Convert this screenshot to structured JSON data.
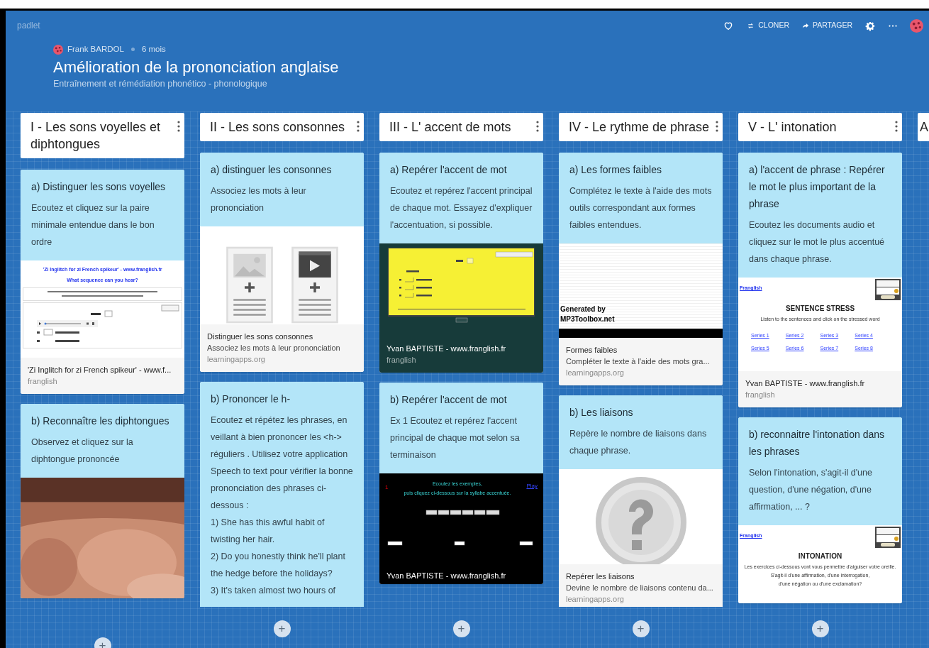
{
  "app": {
    "logo": "padlet"
  },
  "toolbar": [
    {
      "kind": "like"
    },
    {
      "kind": "clone",
      "label": "CLONER"
    },
    {
      "kind": "share",
      "label": "PARTAGER"
    },
    {
      "kind": "settings"
    },
    {
      "kind": "more"
    },
    {
      "kind": "avatar"
    }
  ],
  "board": {
    "author": "Frank BARDOL",
    "age": "6 mois",
    "title": "Amélioration de la prononciation anglaise",
    "subtitle": "Entraînement et rémédiation phonético - phonologique"
  },
  "columns": [
    {
      "title": "I - Les sons voyelles et diphtongues",
      "add_label": "+",
      "posts": [
        {
          "title": "a) Distinguer les sons voyelles",
          "body": [
            "Ecoutez et cliquez sur la paire minimale entendue dans le bon ordre"
          ],
          "attachment": {
            "dark": false,
            "preview": {
              "kind": "pairs_page",
              "heading": "'Zi Inglitch for zi French spikeur' - www.franglish.fr",
              "question": "What sequence can you hear?"
            },
            "title": "'Zi Inglitch for zi French spikeur' - www.f...",
            "source": "franglish"
          }
        },
        {
          "title": "b) Reconnaître les diphtongues",
          "body": [
            "Observez et cliquez sur la diphtongue prononcée"
          ],
          "attachment": {
            "preview": {
              "kind": "picture"
            }
          }
        }
      ]
    },
    {
      "title": "II - Les sons consonnes",
      "add_label": "+",
      "posts": [
        {
          "title": "a) distinguer les consonnes",
          "body": [
            "Associez les mots à leur prononciation"
          ],
          "attachment": {
            "dark": false,
            "preview": {
              "kind": "doc_placeholders"
            },
            "title": "Distinguer les sons consonnes",
            "description": "Associez les mots à leur prononciation",
            "source": "learningapps.org"
          }
        },
        {
          "title": "b) Prononcer le h-",
          "body": [
            "Ecoutez et répétez les phrases, en veillant à bien prononcer les <h-> réguliers . Utilisez votre application Speech to text pour vérifier la bonne prononciation des phrases ci-dessous :",
            "1) She has this awful habit of twisting her hair.",
            "2) Do you honestly think he'll plant the hedge before the holidays?",
            "3) It's taken almost two hours of"
          ]
        }
      ]
    },
    {
      "title": "III - L' accent de mots",
      "add_label": "+",
      "posts": [
        {
          "title": "a) Repérer l'accent de mot",
          "body": [
            "Ecoutez et repérez l'accent principal de chaque mot. Essayez d'expliquer l'accentuation, si possible."
          ],
          "attachment": {
            "dark": true,
            "preview": {
              "kind": "yellow_quiz"
            },
            "title": "Yvan BAPTISTE - www.franglish.fr",
            "source": "franglish"
          }
        },
        {
          "title": "b) Repérer l'accent de mot",
          "body": [
            "Ex 1 Ecoutez et repérez l'accent principal de chaque mot selon sa terminaison"
          ],
          "attachment": {
            "dark": true,
            "preview": {
              "kind": "black_quiz",
              "instructions": [
                "Ecoutez les exemples,",
                "puis cliquez ci-dessous sur la syllabe accentuée."
              ],
              "number": "1",
              "play": "Play"
            },
            "title": "Yvan BAPTISTE - www.franglish.fr"
          }
        }
      ]
    },
    {
      "title": "IV - Le rythme de phrase",
      "add_label": "+",
      "posts": [
        {
          "title": "a) Les formes faibles",
          "body": [
            "Complétez le texte à l'aide des mots outils correspondant aux formes faibles entendues."
          ],
          "attachment": {
            "dark": false,
            "preview": {
              "kind": "audio_waveform",
              "lines": [
                "Generated by",
                "MP3Toolbox.net"
              ]
            },
            "title": "Formes faibles",
            "description": "Compléter le texte à l'aide des mots gra...",
            "source": "learningapps.org"
          }
        },
        {
          "title": "b) Les liaisons",
          "body": [
            "Repère le nombre de liaisons dans chaque phrase."
          ],
          "attachment": {
            "dark": false,
            "preview": {
              "kind": "question_mark"
            },
            "title": "Repérer les liaisons",
            "description": "Devine le nombre de liaisons contenu da...",
            "source": "learningapps.org"
          }
        }
      ]
    },
    {
      "title": "V - L' intonation",
      "add_label": "+",
      "posts": [
        {
          "title": "a) l'accent de phrase : Repérer le mot le plus important de la phrase",
          "body": [
            "Ecoutez les documents audio et cliquez sur le mot le plus accentué dans chaque phrase."
          ],
          "attachment": {
            "dark": false,
            "preview": {
              "kind": "exercise_page",
              "link": "Franglish",
              "heading": "SENTENCE STRESS",
              "lines": [
                "Listen to the sentences and click on the stressed word"
              ],
              "links": [
                "Series 1",
                "Series 2",
                "Series 3",
                "Series 4",
                "Series 5",
                "Series 6",
                "Series 7",
                "Series 8"
              ]
            },
            "title": "Yvan BAPTISTE - www.franglish.fr",
            "source": "franglish"
          }
        },
        {
          "title": "b) reconnaitre l'intonation dans les phrases",
          "body": [
            "Selon l'intonation, s'agit-il d'une question, d'une négation, d'une affirmation, ... ?"
          ],
          "attachment": {
            "preview": {
              "kind": "exercise_page",
              "link": "Franglish",
              "heading": "INTONATION",
              "lines": [
                "Les exercices ci-dessous vont vous permettre d'aiguiser votre oreille.",
                "S'agit-il d'une affirmation, d'une interrogation,",
                "d'une négation ou d'une exclamation?"
              ]
            }
          }
        }
      ]
    },
    {
      "title": "A"
    }
  ]
}
